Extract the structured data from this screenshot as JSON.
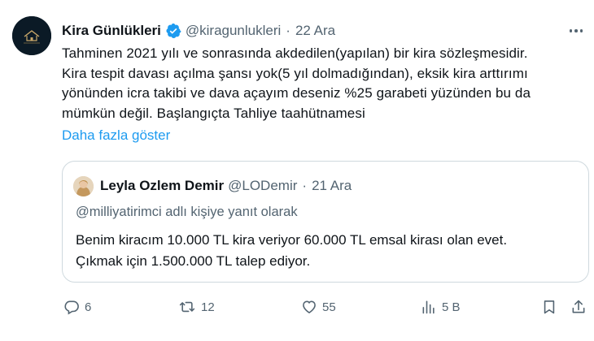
{
  "author": {
    "display_name": "Kira Günlükleri",
    "handle": "@kiragunlukleri",
    "separator": "·",
    "time": "22 Ara",
    "verified": true
  },
  "body_lines": [
    "Tahminen 2021 yılı ve sonrasında akdedilen(yapılan) bir kira sözleşmesidir.",
    "Kira tespit davası açılma şansı yok(5 yıl dolmadığından), eksik kira arttırımı",
    "yönünden icra takibi ve dava açayım deseniz %25 garabeti yüzünden bu da",
    "mümkün değil. Başlangıçta Tahliye taahütnamesi"
  ],
  "show_more_label": "Daha fazla göster",
  "quoted": {
    "display_name": "Leyla Ozlem Demir",
    "handle": "@LODemir",
    "separator": "·",
    "time": "21 Ara",
    "reply_context": "@milliyatirimci adlı kişiye yanıt olarak",
    "text_lines": [
      "Benim kiracım 10.000 TL kira veriyor 60.000 TL emsal kirası olan evet.",
      "Çıkmak için 1.500.000 TL talep ediyor."
    ]
  },
  "actions": {
    "reply_count": "6",
    "retweet_count": "12",
    "like_count": "55",
    "views_count": "5 B"
  },
  "colors": {
    "text_primary": "#0f1419",
    "text_secondary": "#536471",
    "accent": "#1d9bf0",
    "border": "#cfd9de"
  },
  "icons": {
    "verified": "verified-badge-icon",
    "more": "more-options-icon",
    "reply": "reply-icon",
    "retweet": "retweet-icon",
    "like": "heart-icon",
    "views": "views-icon",
    "bookmark": "bookmark-icon",
    "share": "share-icon"
  }
}
